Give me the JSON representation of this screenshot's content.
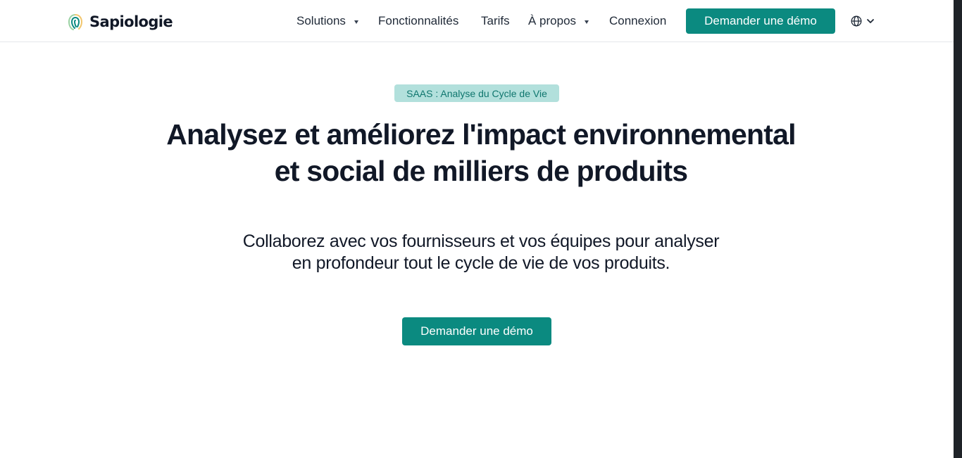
{
  "brand": {
    "name": "Sapiologie",
    "logo_icon": "fingerprint-leaf-icon",
    "accent_color": "#0b8a80",
    "badge_bg": "#b2e0dc"
  },
  "nav": {
    "items": [
      {
        "label": "Solutions",
        "has_dropdown": true
      },
      {
        "label": "Fonctionnalités",
        "has_dropdown": false
      },
      {
        "label": "Tarifs",
        "has_dropdown": false
      },
      {
        "label": "À propos",
        "has_dropdown": true
      },
      {
        "label": "Connexion",
        "has_dropdown": false
      }
    ],
    "cta_label": "Demander une démo",
    "language_icon": "globe-icon"
  },
  "hero": {
    "badge": "SAAS : Analyse du Cycle de Vie",
    "title_line1": "Analysez et améliorez l'impact environnemental",
    "title_line2": "et social de milliers de produits",
    "subtitle_line1": "Collaborez avec vos fournisseurs et vos équipes pour analyser",
    "subtitle_line2": "en profondeur tout le cycle de vie de vos produits.",
    "cta_label": "Demander une démo"
  }
}
